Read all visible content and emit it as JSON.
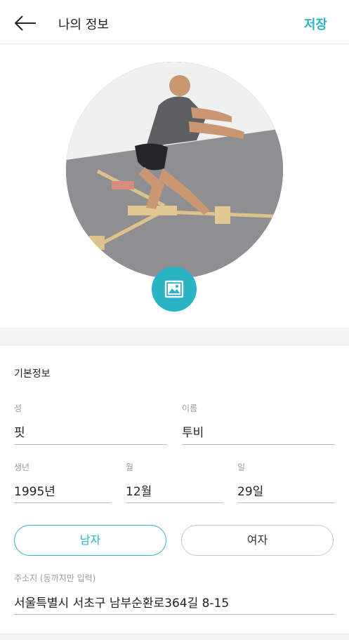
{
  "header": {
    "title": "나의 정보",
    "save_label": "저장"
  },
  "form": {
    "section_title": "기본정보",
    "last_name": {
      "label": "성",
      "value": "핏"
    },
    "first_name": {
      "label": "이름",
      "value": "투비"
    },
    "birth": {
      "year": {
        "label": "생년",
        "value": "1995년"
      },
      "month": {
        "label": "월",
        "value": "12월"
      },
      "day": {
        "label": "일",
        "value": "29일"
      }
    },
    "gender": {
      "male": "남자",
      "female": "여자",
      "selected": "male"
    },
    "address": {
      "label": "주소지 (동까지만 입력)",
      "value": "서울특별시 서초구 남부순환로364길 8-15"
    }
  },
  "colors": {
    "accent": "#29b4c8",
    "text": "#222222",
    "label": "#9a9a9a"
  }
}
